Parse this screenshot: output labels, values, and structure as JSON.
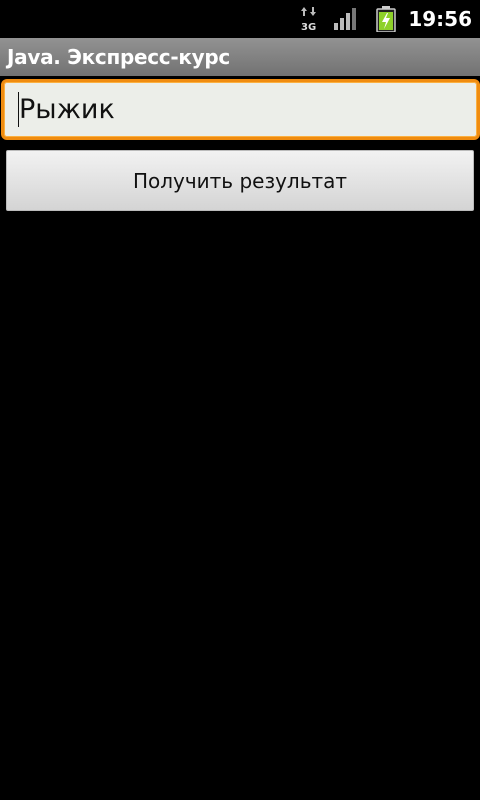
{
  "status_bar": {
    "network_icon": "3g-data-icon",
    "network_label": "3G",
    "signal_icon": "signal-strength-icon",
    "battery_icon": "battery-charging-icon",
    "battery_color": "#8ed12a",
    "time": "19:56"
  },
  "title_bar": {
    "title": "Java. Экспресс-курс"
  },
  "main": {
    "input": {
      "value": "Рыжик",
      "focus_color": "#f08c10"
    },
    "button": {
      "label": "Получить результат"
    }
  }
}
